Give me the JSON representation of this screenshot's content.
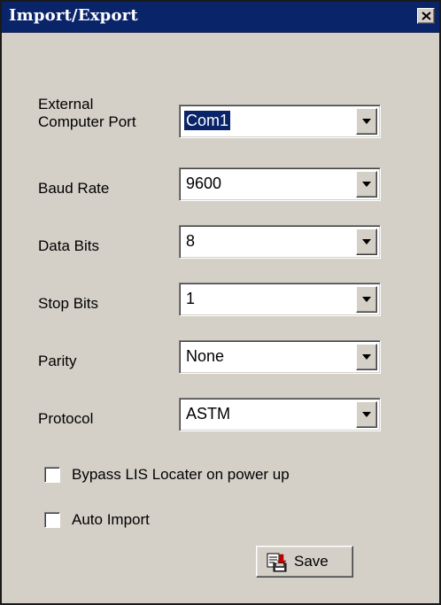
{
  "window": {
    "title": "Import/Export"
  },
  "fields": {
    "port": {
      "label_line1": "External",
      "label_line2": "Computer Port",
      "value": "Com1"
    },
    "baud_rate": {
      "label": "Baud Rate",
      "value": "9600"
    },
    "data_bits": {
      "label": "Data Bits",
      "value": "8"
    },
    "stop_bits": {
      "label": "Stop Bits",
      "value": "1"
    },
    "parity": {
      "label": "Parity",
      "value": "None"
    },
    "protocol": {
      "label": "Protocol",
      "value": "ASTM"
    }
  },
  "checkboxes": {
    "bypass_lis": {
      "label": "Bypass LIS Locater on power up",
      "checked": false
    },
    "auto_import": {
      "label": "Auto Import",
      "checked": false
    }
  },
  "buttons": {
    "save_label": "Save"
  },
  "icons": {
    "close": "close-icon",
    "dropdown": "chevron-down-icon",
    "save": "save-icon"
  },
  "colors": {
    "titlebar": "#0a246a",
    "face": "#d4d0c8",
    "selection": "#0a246a"
  }
}
